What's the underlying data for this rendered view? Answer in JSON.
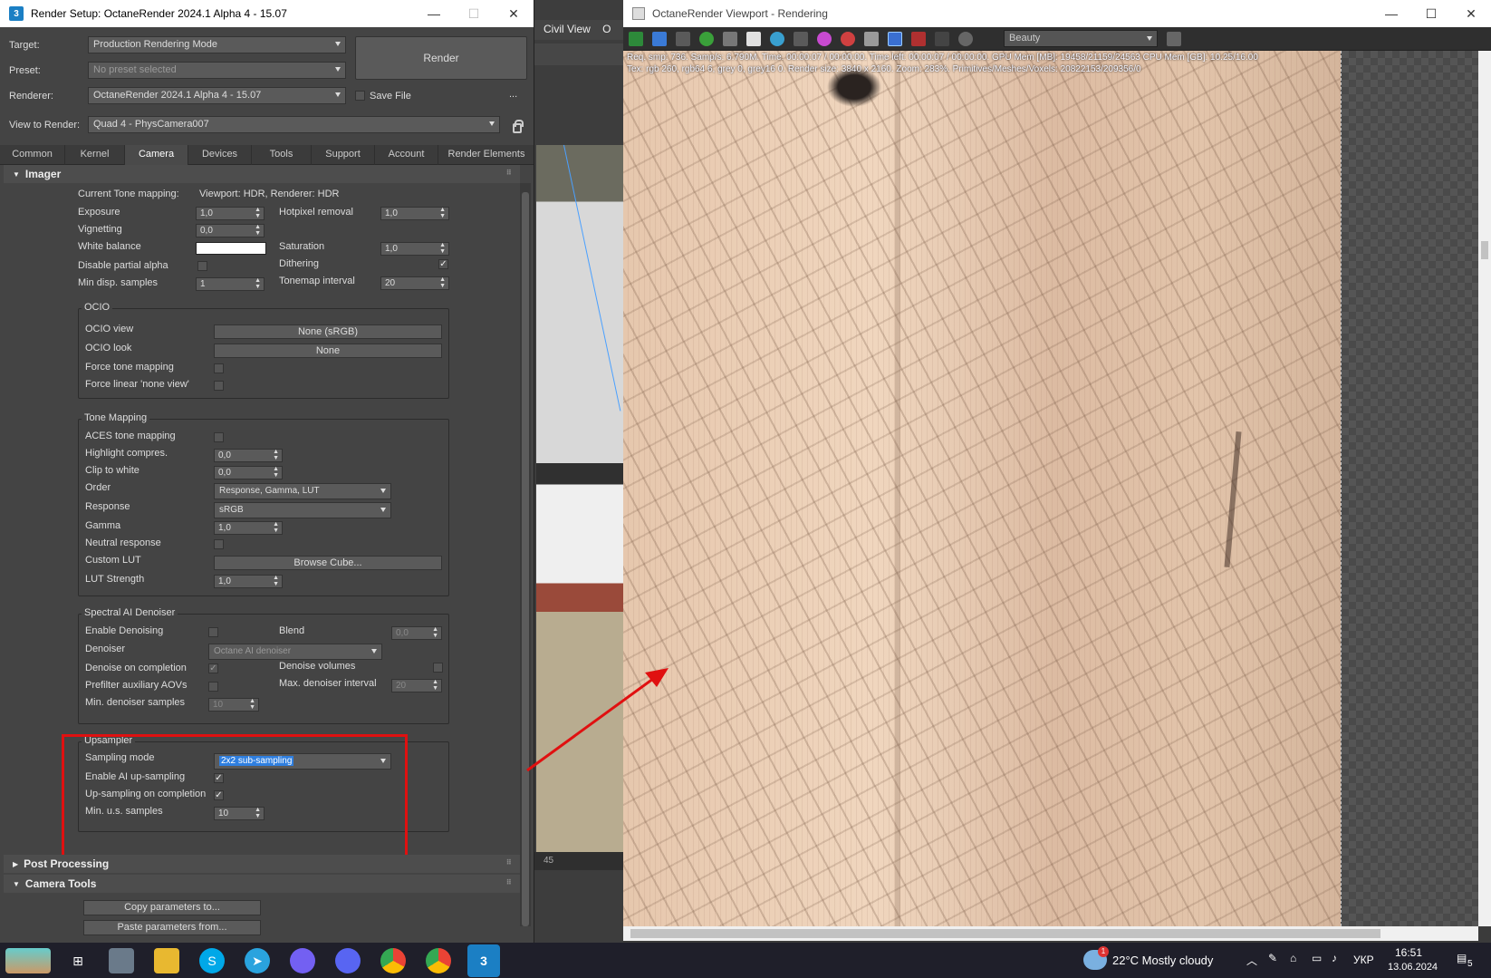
{
  "render_setup": {
    "title": "Render Setup: OctaneRender 2024.1 Alpha 4 - 15.07",
    "app_icon": "3",
    "target_label": "Target:",
    "target_value": "Production Rendering Mode",
    "preset_label": "Preset:",
    "preset_value": "No preset selected",
    "renderer_label": "Renderer:",
    "renderer_value": "OctaneRender 2024.1 Alpha 4 - 15.07",
    "save_file_label": "Save File",
    "more_label": "...",
    "view_label": "View to Render:",
    "view_value": "Quad 4 - PhysCamera007",
    "render_label": "Render",
    "tabs": [
      "Common",
      "Kernel",
      "Camera",
      "Devices",
      "Tools",
      "Support",
      "Account",
      "Render Elements"
    ],
    "active_tab": "Camera"
  },
  "imager": {
    "header": "Imager",
    "current_tm_label": "Current Tone mapping:",
    "current_tm_value": "Viewport: HDR, Renderer: HDR",
    "exposure_label": "Exposure",
    "exposure": "1,0",
    "vignetting_label": "Vignetting",
    "vignetting": "0,0",
    "white_balance_label": "White balance",
    "disable_alpha_label": "Disable partial alpha",
    "min_disp_label": "Min disp. samples",
    "min_disp": "1",
    "hotpixel_label": "Hotpixel removal",
    "hotpixel": "1,0",
    "saturation_label": "Saturation",
    "saturation": "1,0",
    "dithering_label": "Dithering",
    "tonemap_interval_label": "Tonemap interval",
    "tonemap_interval": "20"
  },
  "ocio": {
    "title": "OCIO",
    "view_label": "OCIO view",
    "view_value": "None (sRGB)",
    "look_label": "OCIO look",
    "look_value": "None",
    "force_tm_label": "Force tone mapping",
    "force_linear_label": "Force linear 'none view'"
  },
  "tone_mapping": {
    "title": "Tone Mapping",
    "aces_label": "ACES tone mapping",
    "highlight_label": "Highlight compres.",
    "highlight": "0,0",
    "clip_label": "Clip to white",
    "clip": "0,0",
    "order_label": "Order",
    "order": "Response, Gamma, LUT",
    "response_label": "Response",
    "response": "sRGB",
    "gamma_label": "Gamma",
    "gamma": "1,0",
    "neutral_label": "Neutral response",
    "custom_lut_label": "Custom LUT",
    "browse_label": "Browse Cube...",
    "lut_strength_label": "LUT Strength",
    "lut_strength": "1,0"
  },
  "denoiser": {
    "title": "Spectral AI Denoiser",
    "enable_label": "Enable Denoising",
    "blend_label": "Blend",
    "blend": "0,0",
    "denoiser_label": "Denoiser",
    "denoiser_value": "Octane AI denoiser",
    "on_completion_label": "Denoise on completion",
    "volumes_label": "Denoise volumes",
    "prefilter_label": "Prefilter auxiliary AOVs",
    "max_interval_label": "Max. denoiser interval",
    "max_interval": "20",
    "min_samples_label": "Min. denoiser samples",
    "min_samples": "10"
  },
  "upsampler": {
    "title": "Upsampler",
    "mode_label": "Sampling mode",
    "mode_value": "2x2 sub-sampling",
    "ai_label": "Enable AI up-sampling",
    "completion_label": "Up-sampling on completion",
    "min_label": "Min. u.s. samples",
    "min_value": "10"
  },
  "rollouts": {
    "post_processing": "Post Processing",
    "camera_tools": "Camera Tools",
    "copy_label": "Copy parameters to...",
    "paste_label": "Paste parameters from..."
  },
  "max_bg": {
    "view_label": "Civil View",
    "extra_label": "O",
    "ruler_tick": "45"
  },
  "viewport": {
    "title": "OctaneRender Viewport - Rendering",
    "passes_value": "Beauty",
    "info_line1": "Req. smp: 736.   Samp/s: 6.790M.   Time: 00:00:07 / 00:00:00.   Time left: 00:00:07 / 00:00:00.   GPU Mem [MB]: 19458/21159/24563   CPU Mem [GB]: 10.25/16.00",
    "info_line2": "Tex: rgb 260, rgb64 6, grey 0, grey16 0.   Render size: 3840 x 2160.   Zoom: 283%.   Primitives/Meshes/Voxels: 20822153/209356/0"
  },
  "taskbar": {
    "weather_badge": "1",
    "weather": "22°C  Mostly cloudy",
    "lang": "УКР",
    "time": "16:51",
    "date": "13.06.2024",
    "notif_count": "5"
  }
}
